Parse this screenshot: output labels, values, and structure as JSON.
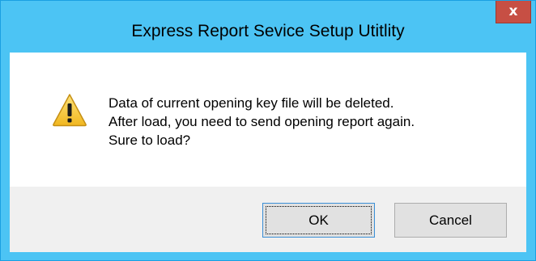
{
  "window": {
    "title": "Express Report Sevice Setup Utitlity",
    "close_glyph": "x"
  },
  "message": {
    "icon": "warning-icon",
    "lines": [
      "Data of current opening key file will be deleted.",
      "After load, you need to send opening report again.",
      "Sure to load?"
    ]
  },
  "buttons": {
    "ok_label": "OK",
    "cancel_label": "Cancel"
  },
  "colors": {
    "titlebar": "#4cc4f4",
    "close_button": "#c74f44",
    "button_area": "#f0f0f0",
    "content": "#ffffff"
  }
}
